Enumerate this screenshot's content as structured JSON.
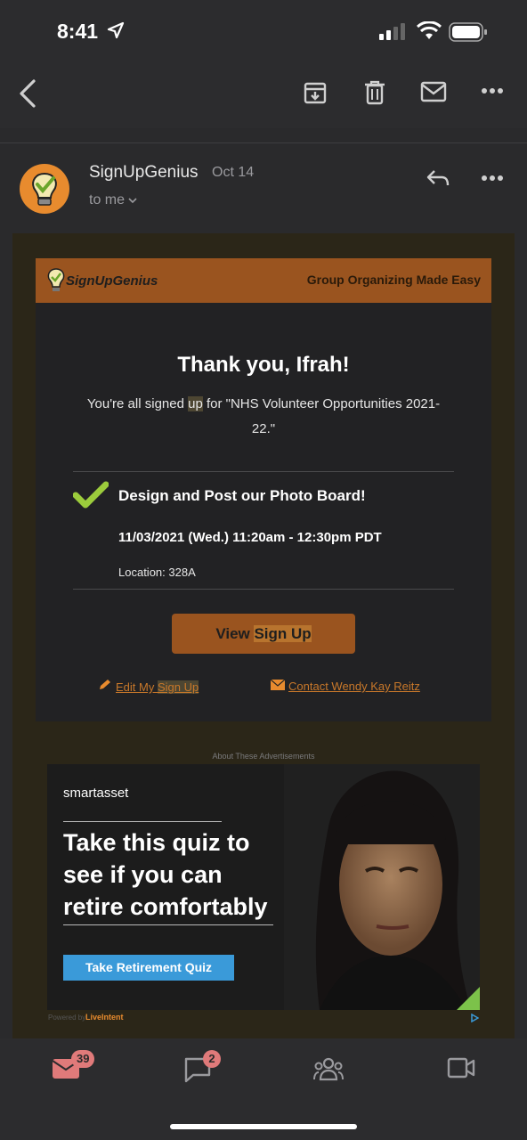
{
  "status_bar": {
    "time": "8:41"
  },
  "sender": {
    "name": "SignUpGenius",
    "date": "Oct 14",
    "recipient": "to me"
  },
  "banner": {
    "logo_text": "SignUpGenius",
    "tagline": "Group Organizing Made Easy"
  },
  "body": {
    "thanks": "Thank you, Ifrah!",
    "signed_prefix": "You're all signed ",
    "signed_highlight": "up",
    "signed_suffix": " for \"NHS Volunteer Opportunities 2021-22.\"",
    "slot_title": "Design and Post our Photo Board!",
    "slot_time": "11/03/2021 (Wed.) 11:20am - 12:30pm PDT",
    "slot_location": "Location: 328A",
    "view_button_prefix": "View ",
    "view_button_highlight": "Sign Up",
    "edit_prefix": "Edit My ",
    "edit_highlight": "Sign Up",
    "contact_link": "Contact Wendy Kay Reitz"
  },
  "ad": {
    "label": "About These Advertisements",
    "brand_a": "smart",
    "brand_b": "asset",
    "headline": "Take this quiz to see if you can retire comfortably",
    "button": "Take Retirement Quiz",
    "powered": "Powered by",
    "network": "LiveIntent"
  },
  "tabbar": {
    "mail_badge": "39",
    "chat_badge": "2"
  },
  "colors": {
    "accent": "#9a541f",
    "link": "#c8782a",
    "badge": "#e07a7a",
    "check": "#9ccc3c",
    "ad_button": "#3a9ad9"
  }
}
